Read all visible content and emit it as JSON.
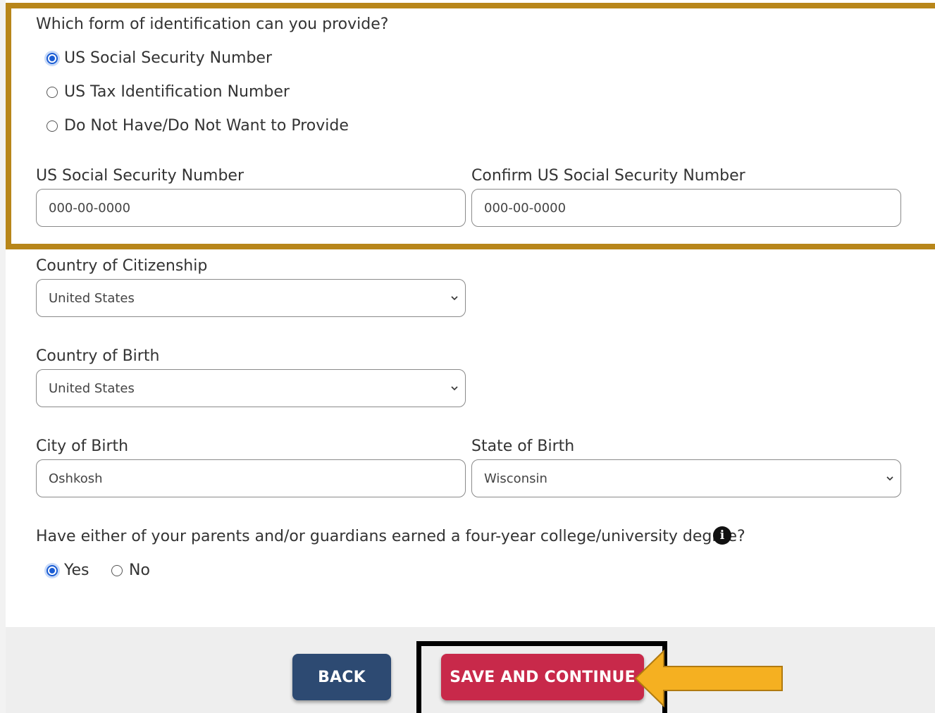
{
  "id_question": {
    "label": "Which form of identification can you provide?",
    "options": [
      {
        "label": "US Social Security Number",
        "checked": true
      },
      {
        "label": "US Tax Identification Number",
        "checked": false
      },
      {
        "label": "Do Not Have/Do Not Want to Provide",
        "checked": false
      }
    ]
  },
  "ssn": {
    "label": "US Social Security Number",
    "placeholder": "000-00-0000",
    "confirm_label": "Confirm US Social Security Number",
    "confirm_placeholder": "000-00-0000"
  },
  "citizenship": {
    "label": "Country of Citizenship",
    "value": "United States"
  },
  "birth_country": {
    "label": "Country of Birth",
    "value": "United States"
  },
  "birth_city": {
    "label": "City of Birth",
    "value": "Oshkosh"
  },
  "birth_state": {
    "label": "State of Birth",
    "value": "Wisconsin"
  },
  "parents_degree": {
    "label": "Have either of your parents and/or guardians earned a four-year college/university degree?",
    "info_icon": "info-icon",
    "options": [
      {
        "label": "Yes",
        "checked": true
      },
      {
        "label": "No",
        "checked": false
      }
    ]
  },
  "footer": {
    "back_label": "BACK",
    "save_label": "SAVE AND CONTINUE"
  },
  "colors": {
    "highlight_border": "#b8861a",
    "back_button": "#2d4a72",
    "save_button": "#c8294a",
    "arrow": "#f5b021",
    "radio_checked": "#1b5dd4"
  }
}
